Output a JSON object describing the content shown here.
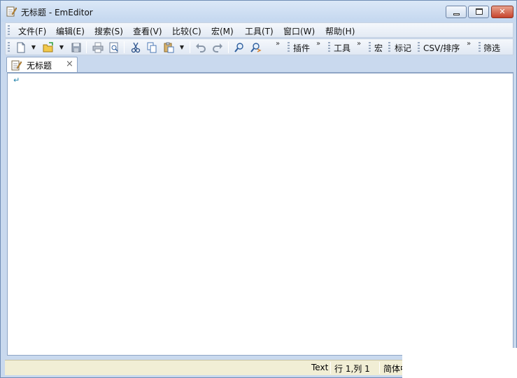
{
  "window": {
    "title": "无标题 - EmEditor",
    "app_icon": "notepad-pencil-icon"
  },
  "titlebar_buttons": {
    "minimize": "minimize-icon",
    "maximize": "maximize-icon",
    "close": "close-icon",
    "close_color": "#c6432c"
  },
  "menubar": {
    "items": [
      {
        "label": "文件(F)"
      },
      {
        "label": "编辑(E)"
      },
      {
        "label": "搜索(S)"
      },
      {
        "label": "查看(V)"
      },
      {
        "label": "比较(C)"
      },
      {
        "label": "宏(M)"
      },
      {
        "label": "工具(T)"
      },
      {
        "label": "窗口(W)"
      },
      {
        "label": "帮助(H)"
      }
    ]
  },
  "toolbar": {
    "icons": [
      "new-file-icon",
      "open-folder-icon",
      "save-icon",
      "print-icon",
      "print-preview-icon",
      "cut-icon",
      "copy-icon",
      "paste-icon",
      "undo-icon",
      "redo-icon",
      "find-icon",
      "replace-icon"
    ],
    "chevron": "»",
    "labels": {
      "plugins": "插件",
      "tools": "工具",
      "macros": "宏",
      "markers": "标记",
      "csv_sort": "CSV/排序",
      "filter": "筛选"
    }
  },
  "tabs": [
    {
      "label": "无标题",
      "close": "×"
    }
  ],
  "editor": {
    "eol_mark": "↵"
  },
  "statusbar": {
    "mode": "Text",
    "position": "行 1,列 1",
    "encoding": "简体中"
  }
}
